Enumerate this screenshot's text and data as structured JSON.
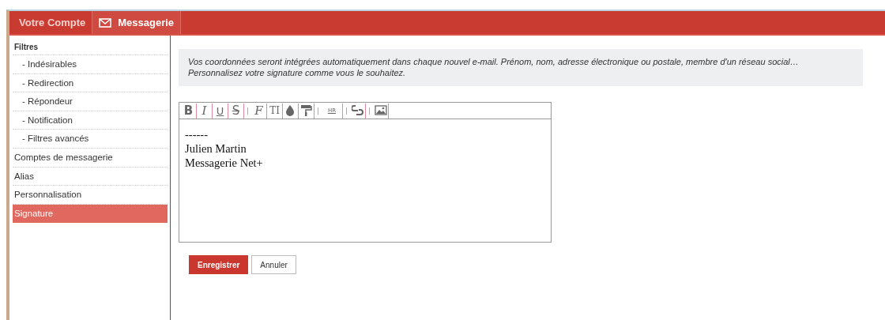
{
  "tabs": [
    {
      "label": "Votre Compte",
      "icon": false,
      "selected": false
    },
    {
      "label": "Messagerie",
      "icon": true,
      "selected": true
    }
  ],
  "sidebar": {
    "items": [
      {
        "label": "Filtres",
        "selected": false,
        "children": [
          {
            "label": "- Indésirables",
            "selected": false
          },
          {
            "label": "- Redirection",
            "selected": false
          },
          {
            "label": "- Répondeur",
            "selected": false
          },
          {
            "label": "- Notification",
            "selected": false
          },
          {
            "label": "- Filtres avancés",
            "selected": false
          }
        ]
      },
      {
        "label": "Comptes de messagerie",
        "selected": false
      },
      {
        "label": "Alias",
        "selected": false
      },
      {
        "label": "Personnalisation",
        "selected": false
      },
      {
        "label": "Signature",
        "selected": true
      }
    ]
  },
  "info": [
    "Vos coordonnées seront intégrées automatiquement dans chaque nouvel e-mail. Prénom, nom, adresse électronique ou postale, membre d'un réseau social…",
    "Personnalisez votre signature comme vous le souhaitez."
  ],
  "toolbar": [
    [
      {
        "kind": "bold",
        "label": "B"
      },
      {
        "kind": "italic",
        "label": "I"
      },
      {
        "kind": "underline",
        "label": "U"
      },
      {
        "kind": "strike",
        "label": "S"
      }
    ],
    [
      {
        "kind": "font",
        "label": "F"
      },
      {
        "kind": "size",
        "label": "TI"
      },
      {
        "kind": "drop"
      },
      {
        "kind": "roller"
      }
    ],
    [
      {
        "kind": "hr",
        "label": "HR"
      }
    ],
    [
      {
        "kind": "link"
      }
    ],
    [
      {
        "kind": "image"
      }
    ]
  ],
  "editor_lines": [
    "------",
    "Julien Martin",
    "Messagerie Net+"
  ],
  "buttons": [
    {
      "label": "Enregistrer",
      "kind": "primary"
    },
    {
      "label": "Annuler",
      "kind": "secondary"
    }
  ]
}
